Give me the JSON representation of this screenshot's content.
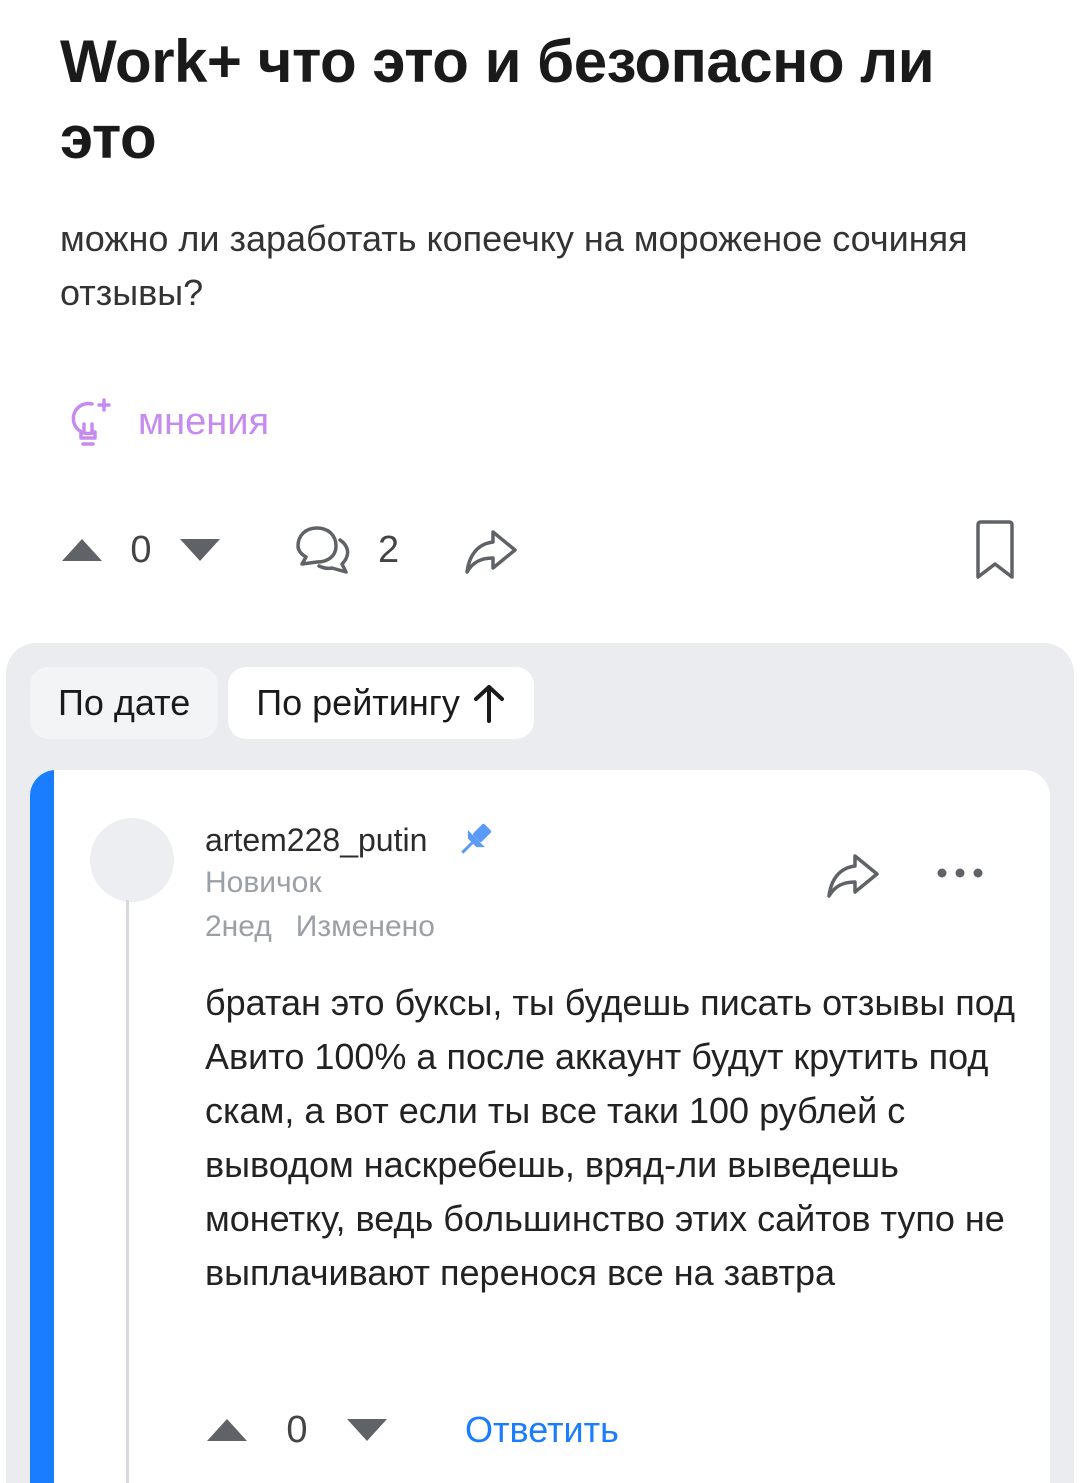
{
  "post": {
    "title": "Work+ что это и безопасно ли это",
    "question": "можно ли заработать копеечку на мороженое сочиняя отзывы?",
    "tag_label": "мнения",
    "score": "0",
    "comment_count": "2"
  },
  "sort": {
    "by_date": "По дате",
    "by_rating": "По рейтингу"
  },
  "comment": {
    "username": "artem228_putin",
    "rank": "Новичок",
    "time": "2нед",
    "edited": "Изменено",
    "text": "братан это буксы, ты будешь писать отзывы под Авито 100% а после аккаунт будут крутить под скам, а вот если ты все таки 100 рублей с выводом наскребешь, вряд-ли выведешь монетку, ведь большинство этих сайтов тупо не выплачивают перенося все на завтра",
    "score": "0",
    "reply_label": "Ответить"
  },
  "colors": {
    "accent_blue": "#1a7cff",
    "opinion_purple": "#c58bf0",
    "panel_gray": "#ebecf0"
  }
}
